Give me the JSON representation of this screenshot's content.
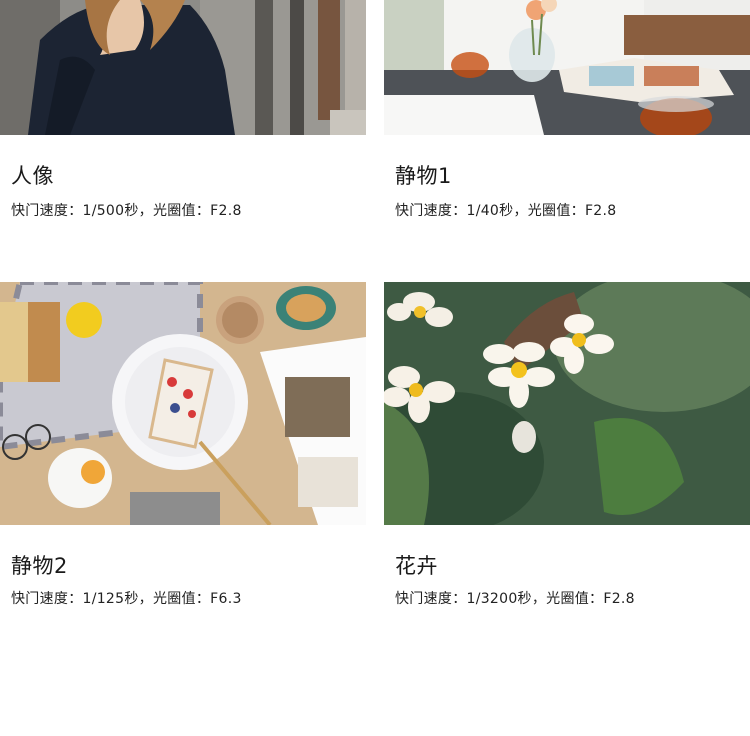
{
  "cards": [
    {
      "title": "人像",
      "meta": "快门速度：1/500秒，光圈值：F2.8"
    },
    {
      "title": "静物1",
      "meta": "快门速度：1/40秒，光圈值：F2.8"
    },
    {
      "title": "静物2",
      "meta": "快门速度：1/125秒，光圈值：F6.3"
    },
    {
      "title": "花卉",
      "meta": "快门速度：1/3200秒，光圈值：F2.8"
    }
  ]
}
